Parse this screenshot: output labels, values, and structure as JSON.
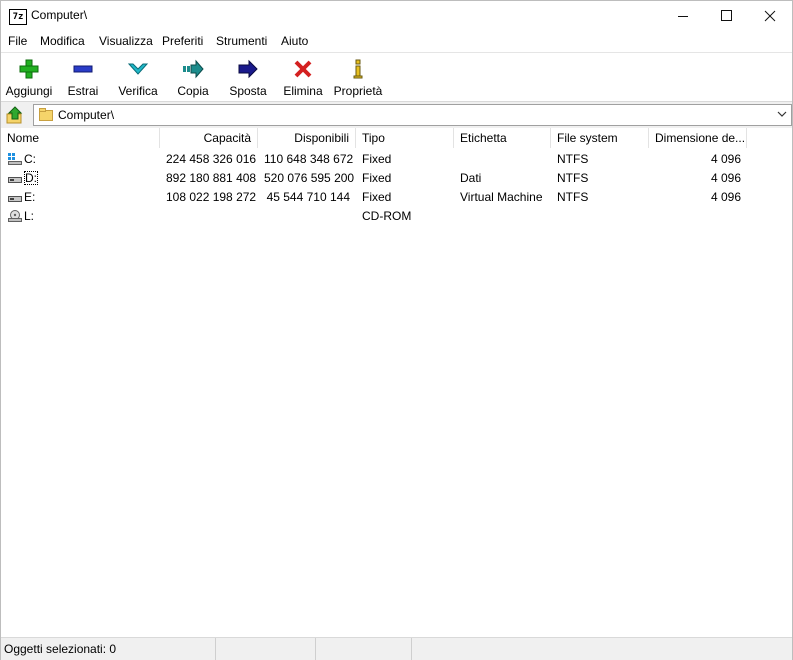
{
  "window": {
    "title": "Computer\\"
  },
  "menu": [
    "File",
    "Modifica",
    "Visualizza",
    "Preferiti",
    "Strumenti",
    "Aiuto"
  ],
  "toolbar": {
    "add": "Aggiungi",
    "extract": "Estrai",
    "test": "Verifica",
    "copy": "Copia",
    "move": "Sposta",
    "delete": "Elimina",
    "info": "Proprietà"
  },
  "address": {
    "path": "Computer\\"
  },
  "columns": [
    "Nome",
    "Capacità",
    "Disponibili",
    "Tipo",
    "Etichetta",
    "File system",
    "Dimensione de..."
  ],
  "rows": [
    {
      "name": "C:",
      "capacity": "224 458 326 016",
      "available": "110 648 348 672",
      "type": "Fixed",
      "label": "",
      "fs": "NTFS",
      "cluster": "4 096",
      "icon": "windows-drive-icon"
    },
    {
      "name": "D:",
      "capacity": "892 180 881 408",
      "available": "520 076 595 200",
      "type": "Fixed",
      "label": "Dati",
      "fs": "NTFS",
      "cluster": "4 096",
      "icon": "hard-drive-icon"
    },
    {
      "name": "E:",
      "capacity": "108 022 198 272",
      "available": "45 544 710 144",
      "type": "Fixed",
      "label": "Virtual Machine",
      "fs": "NTFS",
      "cluster": "4 096",
      "icon": "hard-drive-icon"
    },
    {
      "name": "L:",
      "capacity": "",
      "available": "",
      "type": "CD-ROM",
      "label": "",
      "fs": "",
      "cluster": "",
      "icon": "cd-drive-icon"
    }
  ],
  "status": {
    "selected": "Oggetti selezionati: 0"
  },
  "colors": {
    "add_green": "#22b022",
    "delete_red": "#d42020",
    "move_navy": "#1a1a8c",
    "test_cyan": "#20b8c8",
    "copy_teal": "#1c8c8c",
    "folder_yellow": "#f5d46a"
  }
}
